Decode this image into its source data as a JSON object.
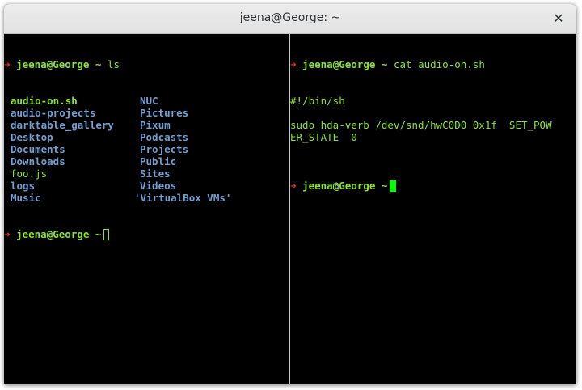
{
  "window": {
    "title": "jeena@George: ~",
    "close_glyph": "✕"
  },
  "prompt": {
    "arrow": "➜",
    "user_host": "jeena@George",
    "dir": "~"
  },
  "left_pane": {
    "command": "ls",
    "col1": [
      {
        "text": "audio-on.sh",
        "kind": "exec"
      },
      {
        "text": "audio-projects",
        "kind": "dir"
      },
      {
        "text": "darktable_gallery",
        "kind": "dir"
      },
      {
        "text": "Desktop",
        "kind": "dir"
      },
      {
        "text": "Documents",
        "kind": "dir"
      },
      {
        "text": "Downloads",
        "kind": "dir"
      },
      {
        "text": "foo.js",
        "kind": "file"
      },
      {
        "text": "logs",
        "kind": "dir"
      },
      {
        "text": "Music",
        "kind": "dir"
      }
    ],
    "col2": [
      {
        "text": "NUC",
        "kind": "dir"
      },
      {
        "text": "Pictures",
        "kind": "dir"
      },
      {
        "text": "Pixum",
        "kind": "dir"
      },
      {
        "text": "Podcasts",
        "kind": "dir"
      },
      {
        "text": "Projects",
        "kind": "dir"
      },
      {
        "text": "Public",
        "kind": "dir"
      },
      {
        "text": "Sites",
        "kind": "dir"
      },
      {
        "text": "Videos",
        "kind": "dir"
      },
      {
        "text": "'VirtualBox VMs'",
        "kind": "dir"
      }
    ]
  },
  "right_pane": {
    "command": "cat audio-on.sh",
    "output": [
      "#!/bin/sh",
      "",
      "sudo hda-verb /dev/snd/hwC0D0 0x1f  SET_POW",
      "ER_STATE  0",
      ""
    ]
  },
  "colors": {
    "prompt_green": "#8ae234",
    "arrow_red": "#ef2929",
    "dir_blue": "#729fcf",
    "cursor_green": "#00ff00"
  }
}
